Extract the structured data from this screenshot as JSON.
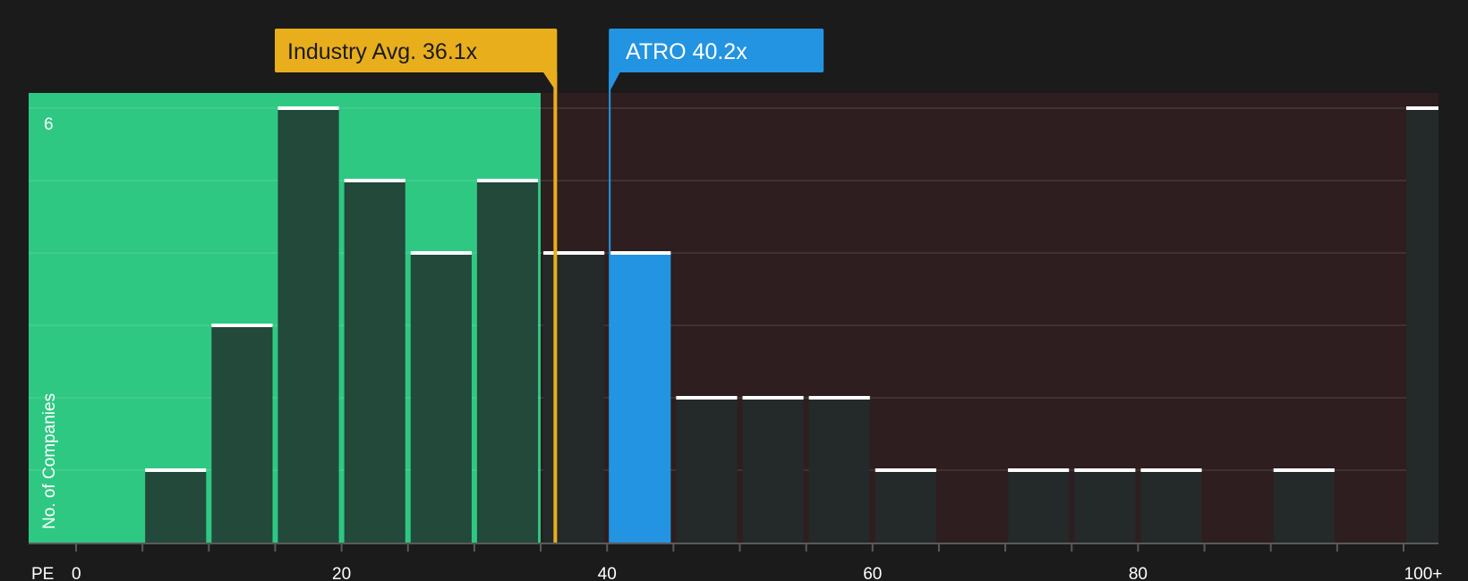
{
  "chart_data": {
    "type": "bar",
    "title": "",
    "xlabel": "PE",
    "ylabel": "No. of Companies",
    "x_ticks": [
      "0",
      "20",
      "40",
      "60",
      "80",
      "100+"
    ],
    "y_tick_label": "6",
    "ylim": [
      0,
      6.2
    ],
    "bin_width": 5,
    "bins": [
      {
        "start": 0,
        "count": 0
      },
      {
        "start": 5,
        "count": 1
      },
      {
        "start": 10,
        "count": 3
      },
      {
        "start": 15,
        "count": 6
      },
      {
        "start": 20,
        "count": 5
      },
      {
        "start": 25,
        "count": 4
      },
      {
        "start": 30,
        "count": 5
      },
      {
        "start": 35,
        "count": 4
      },
      {
        "start": 40,
        "count": 4,
        "highlight": true
      },
      {
        "start": 45,
        "count": 2
      },
      {
        "start": 50,
        "count": 2
      },
      {
        "start": 55,
        "count": 2
      },
      {
        "start": 60,
        "count": 1
      },
      {
        "start": 65,
        "count": 0
      },
      {
        "start": 70,
        "count": 1
      },
      {
        "start": 75,
        "count": 1
      },
      {
        "start": 80,
        "count": 1
      },
      {
        "start": 85,
        "count": 0
      },
      {
        "start": 90,
        "count": 1
      },
      {
        "start": 95,
        "count": 0
      },
      {
        "start": 100,
        "count": 6
      }
    ],
    "industry_avg": {
      "label": "Industry Avg. 36.1x",
      "value": 36.1
    },
    "company": {
      "label": "ATRO 40.2x",
      "value": 40.2
    },
    "green_region_end": 35,
    "grid": true,
    "colors": {
      "background": "#1b1b1c",
      "green_region": "#2ec882",
      "red_region": "#2e1e1f",
      "bar_dark": "#24292a",
      "bar_on_green": "#22493a",
      "highlight_bar": "#2394e2",
      "industry": "#e8ae1c",
      "company": "#2394e2",
      "bar_cap": "#ffffff"
    }
  }
}
